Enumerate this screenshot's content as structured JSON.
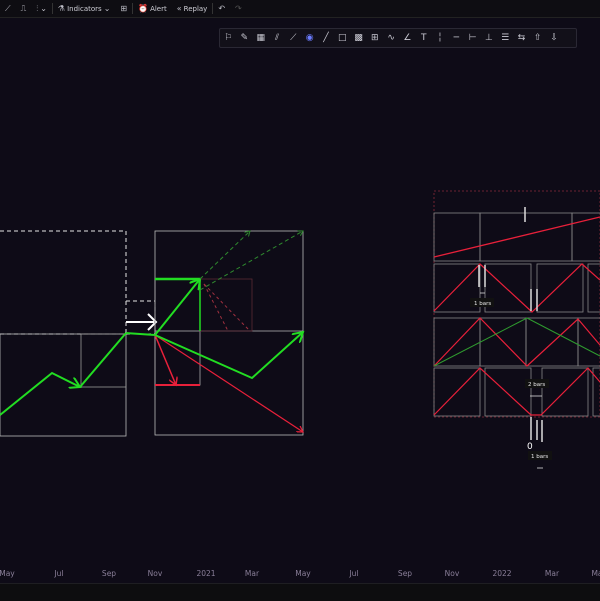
{
  "toolbar": {
    "chart_type_icons": [
      "line-chart-icon",
      "area-chart-icon",
      "candle-chart-icon"
    ],
    "indicators_label": "Indicators",
    "alert_label": "Alert",
    "replay_label": "Replay"
  },
  "drawing_toolbar": {
    "tools": [
      "flag-icon",
      "brush-icon",
      "grid-icon",
      "parallel-channel-icon",
      "pitchfork-icon",
      "play-circle-icon",
      "trend-line-icon",
      "rectangle-icon",
      "pattern-icon",
      "table-icon",
      "wave-icon",
      "angle-icon",
      "text-icon",
      "vertical-line-icon",
      "horizontal-line-icon",
      "date-range-icon",
      "price-range-icon",
      "long-position-icon",
      "short-position-icon",
      "arrow-up-icon",
      "arrow-down-icon"
    ],
    "active_tool": "play-circle-icon",
    "accent_color": "#6b7cff"
  },
  "chart": {
    "background": "#0e0b17",
    "colors": {
      "up": "#22dd22",
      "down": "#e8203a",
      "neutral": "#c8c8c8"
    },
    "labels": {
      "bars_1": "1 bars",
      "bars_2": "2 bars",
      "bars_3": "1 bars",
      "zero": "0"
    }
  },
  "time_axis": {
    "ticks": [
      "May",
      "Jul",
      "Sep",
      "Nov",
      "2021",
      "Mar",
      "May",
      "Jul",
      "Sep",
      "Nov",
      "2022",
      "Mar",
      "Ma"
    ]
  }
}
